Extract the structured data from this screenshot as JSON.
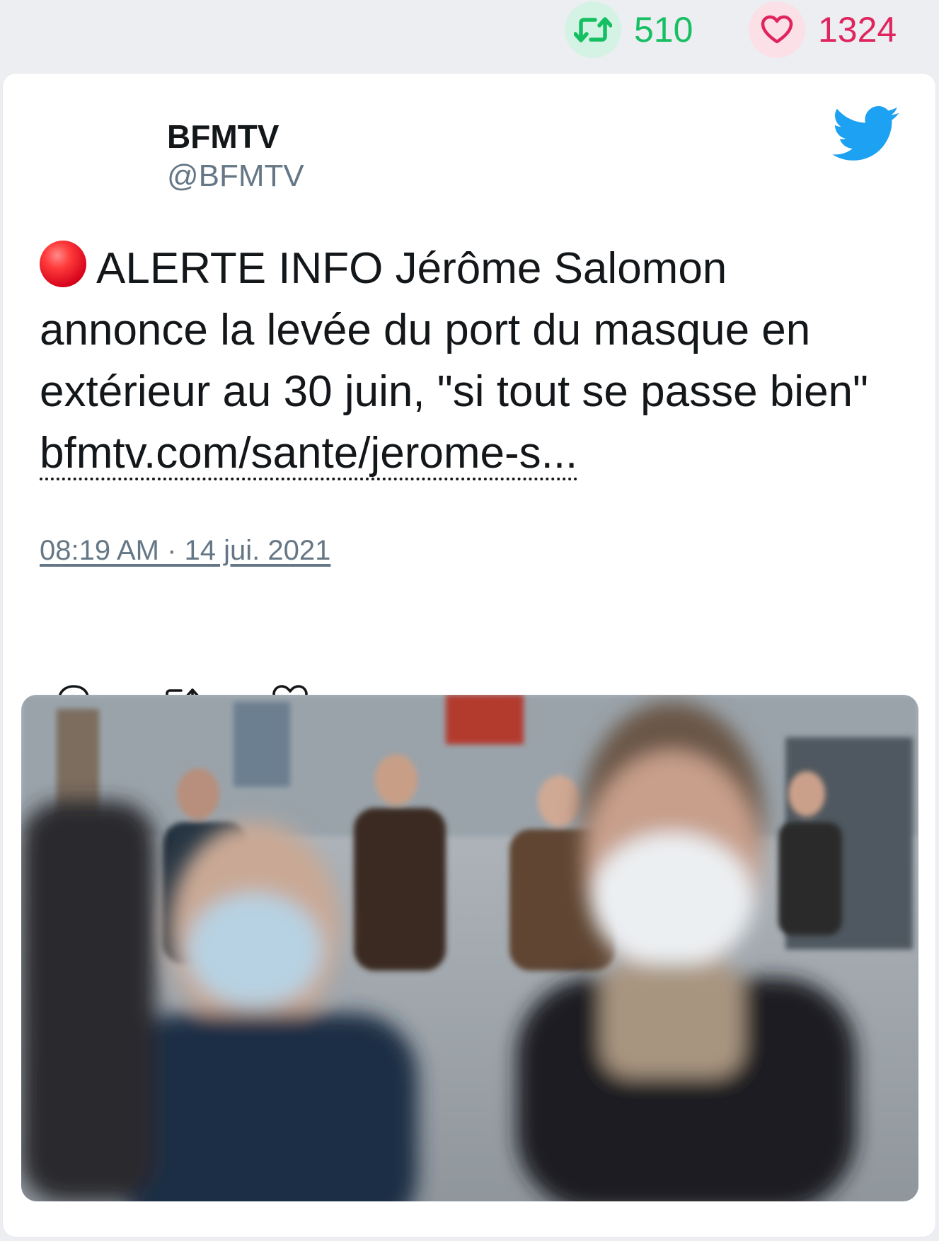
{
  "stats": {
    "retweets": "510",
    "likes": "1324",
    "retweet_color": "#17bf63",
    "like_color": "#e0245e"
  },
  "tweet": {
    "name": "BFMTV",
    "handle": "@BFMTV",
    "logo_icon": "twitter-bird-icon",
    "emoji": "red-circle",
    "text": "ALERTE INFO Jérôme Salomon annonce la levée du port du masque en extérieur au 30 juin, \"si tout se passe bien\"",
    "link": "bfmtv.com/sante/jerome-s...",
    "timestamp": "08:19 AM · 14 jui. 2021",
    "actions": [
      "reply-icon",
      "retweet-icon",
      "like-icon"
    ]
  },
  "media": {
    "icon": "photo-crowd-masks"
  }
}
